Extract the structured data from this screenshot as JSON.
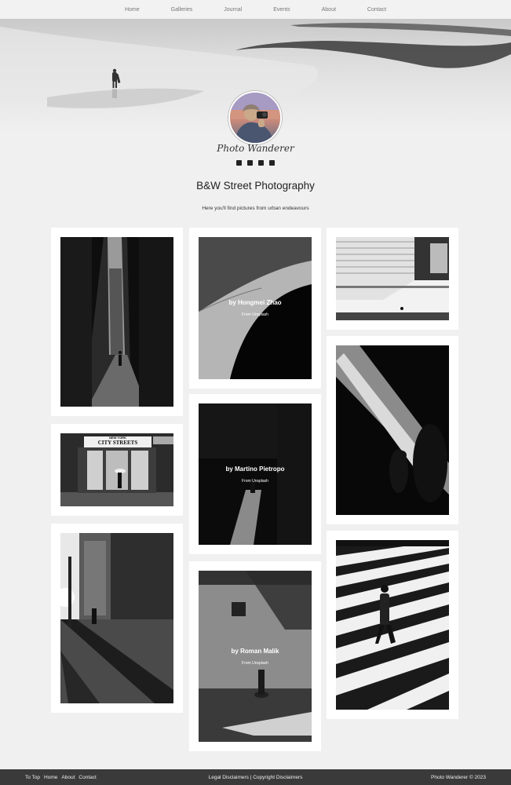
{
  "nav": {
    "items": [
      {
        "label": "Home"
      },
      {
        "label": "Galleries"
      },
      {
        "label": "Journal"
      },
      {
        "label": "Events"
      },
      {
        "label": "About"
      },
      {
        "label": "Contact"
      }
    ]
  },
  "profile": {
    "signature": "Photo Wanderer",
    "socials": [
      "facebook-icon",
      "instagram-icon",
      "youtube-icon",
      "flickr-icon"
    ]
  },
  "page": {
    "title": "B&W Street Photography",
    "subtitle": "Here you'll find pictures from urban endeavours"
  },
  "gallery": {
    "overlays": [
      {
        "by": "by Hongmei Zhao",
        "from": "From Unsplash"
      },
      {
        "by": "by Martino Pietropo",
        "from": "From Unsplash"
      },
      {
        "by": "by Roman Malik",
        "from": "From Unsplash"
      }
    ],
    "sign_text": "CITY STREETS",
    "sign_small": "NEW YORK"
  },
  "footer": {
    "links": [
      {
        "label": "To Top"
      },
      {
        "label": "Home"
      },
      {
        "label": "About"
      },
      {
        "label": "Contact"
      }
    ],
    "middle": "Legal Disclaimers | Copyright Disclaimers",
    "right": "Photo Wanderer © 2023"
  }
}
